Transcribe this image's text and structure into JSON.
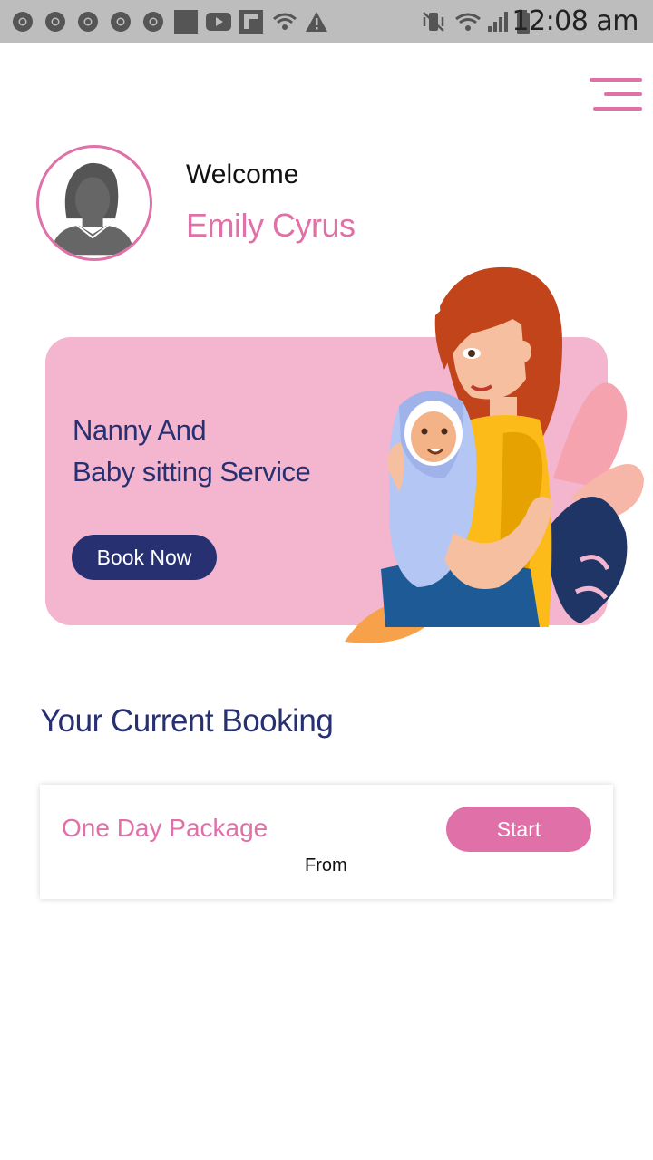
{
  "status_bar": {
    "time": "12:08 am",
    "left_icons": [
      "chrome-icon",
      "chrome-icon",
      "chrome-icon",
      "chrome-icon",
      "chrome-icon",
      "square-icon",
      "youtube-icon",
      "flipboard-icon",
      "wifi-icon",
      "warning-icon"
    ],
    "right_icons": [
      "vibrate-icon",
      "wifi-icon",
      "signal-icon",
      "battery-icon"
    ]
  },
  "header": {
    "menu_icon": "hamburger-menu-icon"
  },
  "profile": {
    "welcome": "Welcome",
    "name": "Emily Cyrus",
    "avatar_icon": "user-silhouette-icon"
  },
  "banner": {
    "title_line1": "Nanny And",
    "title_line2": "Baby sitting Service",
    "button": "Book Now"
  },
  "bookings": {
    "title": "Your Current Booking",
    "items": [
      {
        "package": "One Day Package",
        "from": "From",
        "button": "Start"
      }
    ]
  },
  "colors": {
    "pink": "#e070a8",
    "navy": "#273070",
    "banner_bg": "#f4b5cf"
  }
}
